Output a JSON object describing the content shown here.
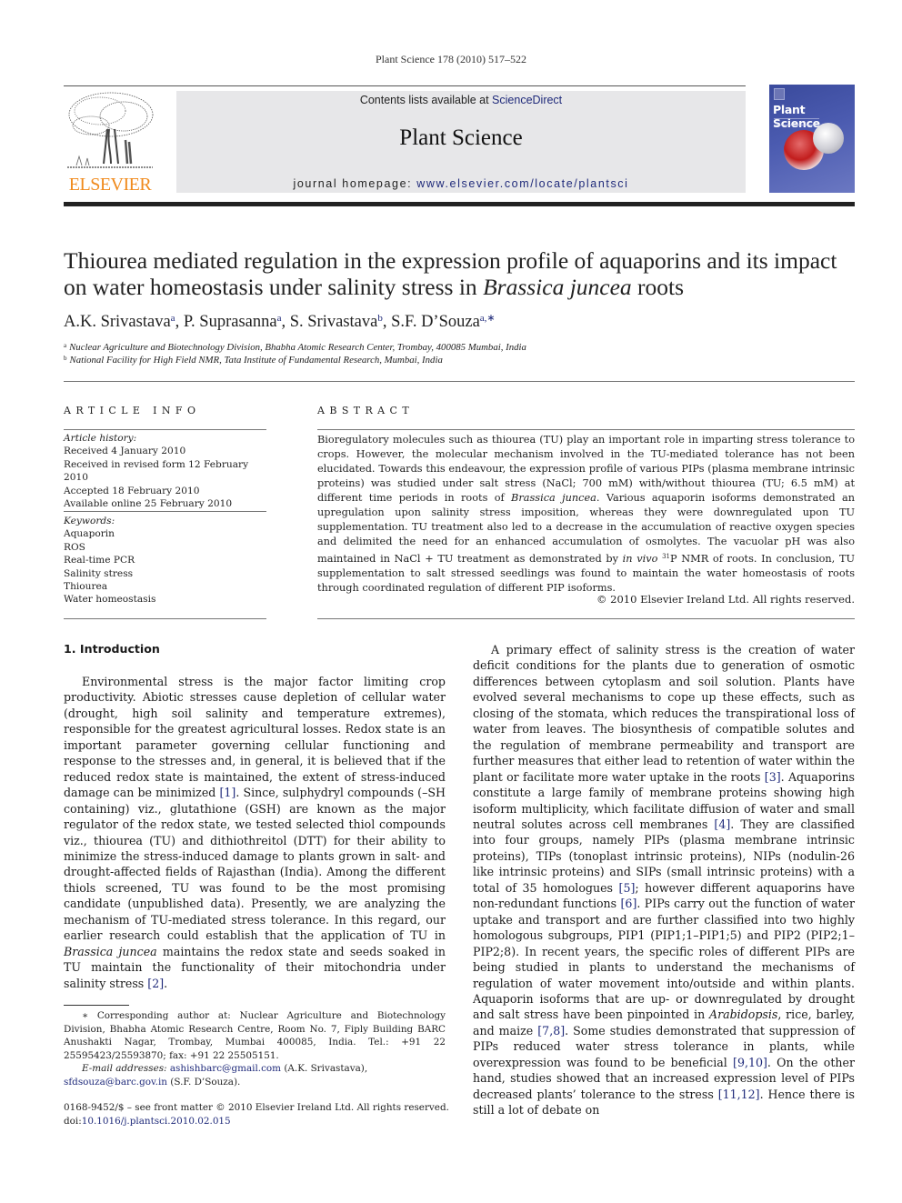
{
  "running_head": "Plant Science 178 (2010) 517–522",
  "header": {
    "publisher": "ELSEVIER",
    "contents_prefix": "Contents lists available at ",
    "contents_link": "ScienceDirect",
    "journal_title": "Plant Science",
    "homepage_prefix": "journal homepage: ",
    "homepage_link": "www.elsevier.com/locate/plantsci",
    "cover_title": "Plant Science",
    "colors": {
      "publisher_orange": "#f08a1c",
      "link_blue": "#1f2a7a",
      "banner_grey": "#e7e7e9",
      "cover_blue": "#4b5bb0"
    }
  },
  "article": {
    "title_part1": "Thiourea mediated regulation in the expression profile of aquaporins and its impact on water homeostasis under salinity stress in ",
    "title_italic": "Brassica juncea",
    "title_part2": " roots",
    "authors": [
      {
        "name": "A.K. Srivastava",
        "sup": "a"
      },
      {
        "name": "P. Suprasanna",
        "sup": "a"
      },
      {
        "name": "S. Srivastava",
        "sup": "b"
      },
      {
        "name": "S.F. D’Souza",
        "sup": "a,∗"
      }
    ],
    "affiliations": [
      {
        "key": "a",
        "text": "Nuclear Agriculture and Biotechnology Division, Bhabha Atomic Research Center, Trombay, 400085 Mumbai, India"
      },
      {
        "key": "b",
        "text": "National Facility for High Field NMR, Tata Institute of Fundamental Research, Mumbai, India"
      }
    ]
  },
  "article_info": {
    "heading": "ARTICLE INFO",
    "history_label": "Article history:",
    "history": [
      "Received 4 January 2010",
      "Received in revised form 12 February 2010",
      "Accepted 18 February 2010",
      "Available online 25 February 2010"
    ],
    "keywords_label": "Keywords:",
    "keywords": [
      "Aquaporin",
      "ROS",
      "Real-time PCR",
      "Salinity stress",
      "Thiourea",
      "Water homeostasis"
    ]
  },
  "abstract": {
    "heading": "ABSTRACT",
    "t1": "Bioregulatory molecules such as thiourea (TU) play an important role in imparting stress tolerance to crops. However, the molecular mechanism involved in the TU-mediated tolerance has not been elucidated. Towards this endeavour, the expression profile of various PIPs (plasma membrane intrinsic proteins) was studied under salt stress (NaCl; 700 mM) with/without thiourea (TU; 6.5 mM) at different time periods in roots of ",
    "i1": "Brassica juncea",
    "t2": ". Various aquaporin isoforms demonstrated an upregulation upon salinity stress imposition, whereas they were downregulated upon TU supplementation. TU treatment also led to a decrease in the accumulation of reactive oxygen species and delimited the need for an enhanced accumulation of osmolytes. The vacuolar pH was also maintained in NaCl + TU treatment as demonstrated by ",
    "i2": "in vivo",
    "sup": "31",
    "t3": "P NMR of roots. In conclusion, TU supplementation to salt stressed seedlings was found to maintain the water homeostasis of roots through coordinated regulation of different PIP isoforms.",
    "copyright": "© 2010 Elsevier Ireland Ltd. All rights reserved."
  },
  "introduction": {
    "heading": "1.  Introduction",
    "p1": [
      "Environmental stress is the major factor limiting crop productivity. Abiotic stresses cause depletion of cellular water (drought, high soil salinity and temperature extremes), responsible for the greatest agricultural losses. Redox state is an important parameter governing cellular functioning and response to the stresses and, in general, it is believed that if the reduced redox state is maintained, the extent of stress-induced damage can be minimized ",
      "[1]",
      ". Since, sulphydryl compounds (–SH containing) viz., glutathione (GSH) are known as the major regulator of the redox state, we tested selected thiol compounds viz., thiourea (TU) and dithiothreitol (DTT) for their ability to minimize the stress-induced damage to plants grown in salt- and drought-affected fields of Rajasthan (India). Among the different thiols screened, TU was found to be the most promising candidate (unpublished data). Presently, we are analyzing the mechanism of TU-mediated stress tolerance. In this regard, our earlier research could establish that the application of TU in ",
      "Brassica juncea",
      " maintains the redox state and seeds soaked in TU maintain the functionality of their mitochondria under salinity stress ",
      "[2]",
      "."
    ],
    "p2": [
      "A primary effect of salinity stress is the creation of water deficit conditions for the plants due to generation of osmotic differences between cytoplasm and soil solution. Plants have evolved several mechanisms to cope up these effects, such as closing of the stomata, which reduces the transpirational loss of water from leaves. The biosynthesis of compatible solutes and the regulation of membrane permeability and transport are further measures that either lead to retention of water within the plant or facilitate more water uptake in the roots ",
      "[3]",
      ". Aquaporins constitute a large family of membrane proteins showing high isoform multiplicity, which facilitate diffusion of water and small neutral solutes across cell membranes ",
      "[4]",
      ". They are classified into four groups, namely PIPs (plasma membrane intrinsic proteins), TIPs (tonoplast intrinsic proteins), NIPs (nodulin-26 like intrinsic proteins) and SIPs (small intrinsic proteins) with a total of 35 homologues ",
      "[5]",
      "; however different aquaporins have non-redundant functions ",
      "[6]",
      ". PIPs carry out the function of water uptake and transport and are further classified into two highly homologous subgroups, PIP1 (PIP1;1–PIP1;5) and PIP2 (PIP2;1–PIP2;8). In recent years, the specific roles of different PIPs are being studied in plants to understand the mechanisms of regulation of water movement into/outside and within plants. Aquaporin isoforms that are up- or downregulated by drought and salt stress have been pinpointed in ",
      "Arabidopsis",
      ", rice, barley, and maize ",
      "[7,8]",
      ". Some studies demonstrated that suppression of PIPs reduced water stress tolerance in plants, while overexpression was found to be beneficial ",
      "[9,10]",
      ". On the other hand, studies showed that an increased expression level of PIPs decreased plants’ tolerance to the stress ",
      "[11,12]",
      ". Hence there is still a lot of debate on"
    ]
  },
  "footnote": {
    "corresponding": "∗  Corresponding author at: Nuclear Agriculture and Biotechnology Division, Bhabha Atomic Research Centre, Room No. 7, Fiply Building BARC Anushakti Nagar, Trombay, Mumbai 400085, India. Tel.: +91 22 25595423/25593870; fax: +91 22 25505151.",
    "email_label": "E-mail addresses:",
    "email1": "ashishbarc@gmail.com",
    "email1_owner": " (A.K. Srivastava),",
    "email2": "sfdsouza@barc.gov.in",
    "email2_owner": " (S.F. D’Souza)."
  },
  "front_matter": {
    "issn_line": "0168-9452/$ – see front matter © 2010 Elsevier Ireland Ltd. All rights reserved.",
    "doi_prefix": "doi:",
    "doi": "10.1016/j.plantsci.2010.02.015"
  }
}
